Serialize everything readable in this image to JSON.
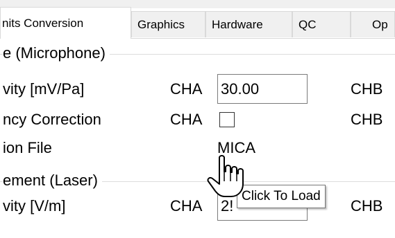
{
  "tabs": [
    {
      "label": "nits Conversion",
      "active": true
    },
    {
      "label": "Graphics",
      "active": false
    },
    {
      "label": "Hardware",
      "active": false
    },
    {
      "label": "QC",
      "active": false
    },
    {
      "label": "Op",
      "active": false
    }
  ],
  "microphone_group": {
    "title": "e (Microphone)",
    "sensitivity": {
      "label": "vity [mV/Pa]",
      "cha_label": "CHA",
      "cha_value": "30.00",
      "chb_label": "CHB"
    },
    "frequency_correction": {
      "label": "ncy Correction",
      "cha_label": "CHA",
      "cha_checked": false,
      "chb_label": "CHB"
    },
    "calibration_file": {
      "label": "ion File",
      "value": "MICA"
    }
  },
  "laser_group": {
    "title": "ement (Laser)",
    "sensitivity": {
      "label": "vity [V/m]",
      "cha_label": "CHA",
      "cha_value": "2!",
      "chb_label": "CHB"
    }
  },
  "tooltip": {
    "text": "Click To Load"
  },
  "cursor": {
    "icon": "hand-pointer-icon"
  }
}
